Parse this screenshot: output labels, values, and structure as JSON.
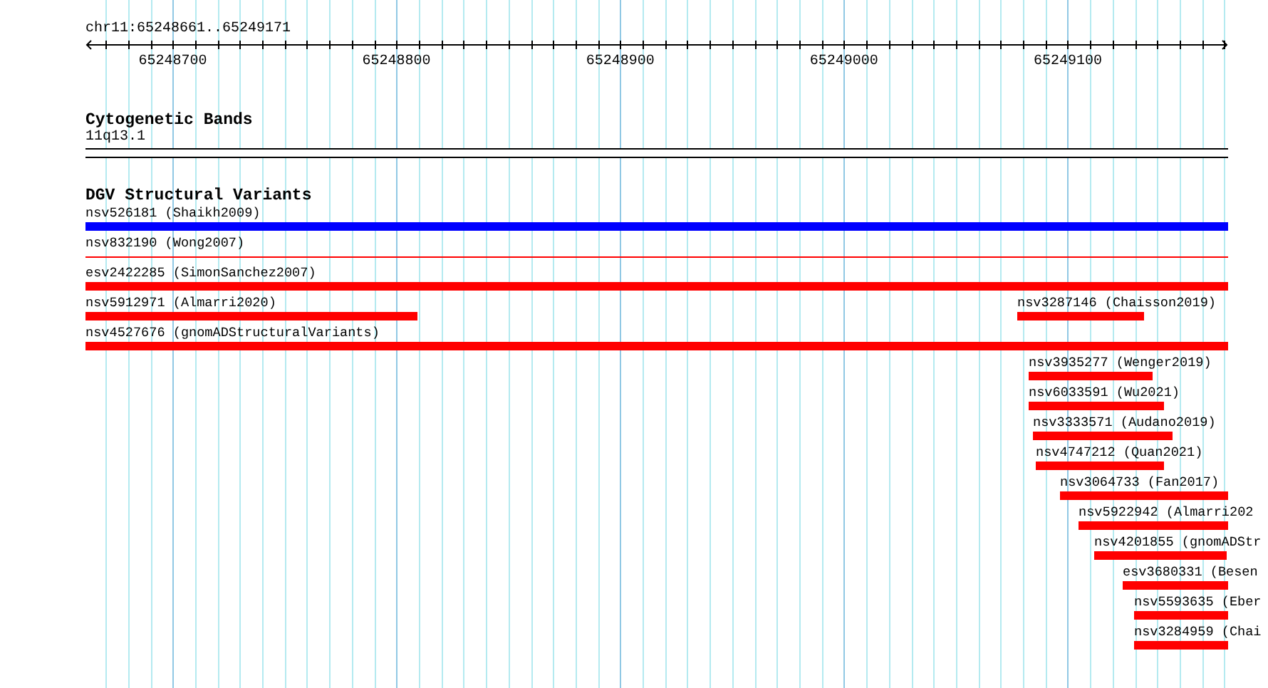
{
  "ruler": {
    "region": "chr11:65248661..65249171",
    "ticks": [
      "65248700",
      "65248800",
      "65248900",
      "65249000",
      "65249100"
    ]
  },
  "tracks": [
    {
      "title": "Cytogenetic Bands",
      "kind": "cytoband",
      "band": "11q13.1"
    },
    {
      "title": "DGV Structural Variants",
      "kind": "variants",
      "rows": [
        [
          {
            "label": "nsv526181 (Shaikh2009)",
            "color": "#0000ff",
            "kind": "thick"
          }
        ],
        [
          {
            "label": "nsv832190 (Wong2007)",
            "color": "#ff0000",
            "kind": "thin"
          }
        ],
        [
          {
            "label": "esv2422285 (SimonSanchez2007)",
            "color": "#ff0000",
            "kind": "thick"
          }
        ],
        [
          {
            "label": "nsv5912971 (Almarri2020)",
            "color": "#ff0000",
            "kind": "thick"
          },
          {
            "label": "nsv3287146 (Chaisson2019)",
            "color": "#ff0000",
            "kind": "thick"
          }
        ],
        [
          {
            "label": "nsv4527676 (gnomADStructuralVariants)",
            "color": "#ff0000",
            "kind": "thick"
          }
        ],
        [
          {
            "label": "nsv3935277 (Wenger2019)",
            "color": "#ff0000",
            "kind": "thick"
          }
        ],
        [
          {
            "label": "nsv6033591 (Wu2021)",
            "color": "#ff0000",
            "kind": "thick"
          }
        ],
        [
          {
            "label": "nsv3333571 (Audano2019)",
            "color": "#ff0000",
            "kind": "thick"
          }
        ],
        [
          {
            "label": "nsv4747212 (Quan2021)",
            "color": "#ff0000",
            "kind": "thick"
          }
        ],
        [
          {
            "label": "nsv3064733 (Fan2017)",
            "color": "#ff0000",
            "kind": "thick"
          }
        ],
        [
          {
            "label": "nsv5922942 (Almarri202",
            "color": "#ff0000",
            "kind": "thick"
          }
        ],
        [
          {
            "label": "nsv4201855 (gnomADStr",
            "color": "#ff0000",
            "kind": "thick"
          }
        ],
        [
          {
            "label": "esv3680331 (Besen",
            "color": "#ff0000",
            "kind": "thick"
          }
        ],
        [
          {
            "label": "nsv5593635 (Eber",
            "color": "#ff0000",
            "kind": "thick"
          }
        ],
        [
          {
            "label": "nsv3284959 (Chai",
            "color": "#ff0000",
            "kind": "thick"
          }
        ]
      ]
    }
  ]
}
